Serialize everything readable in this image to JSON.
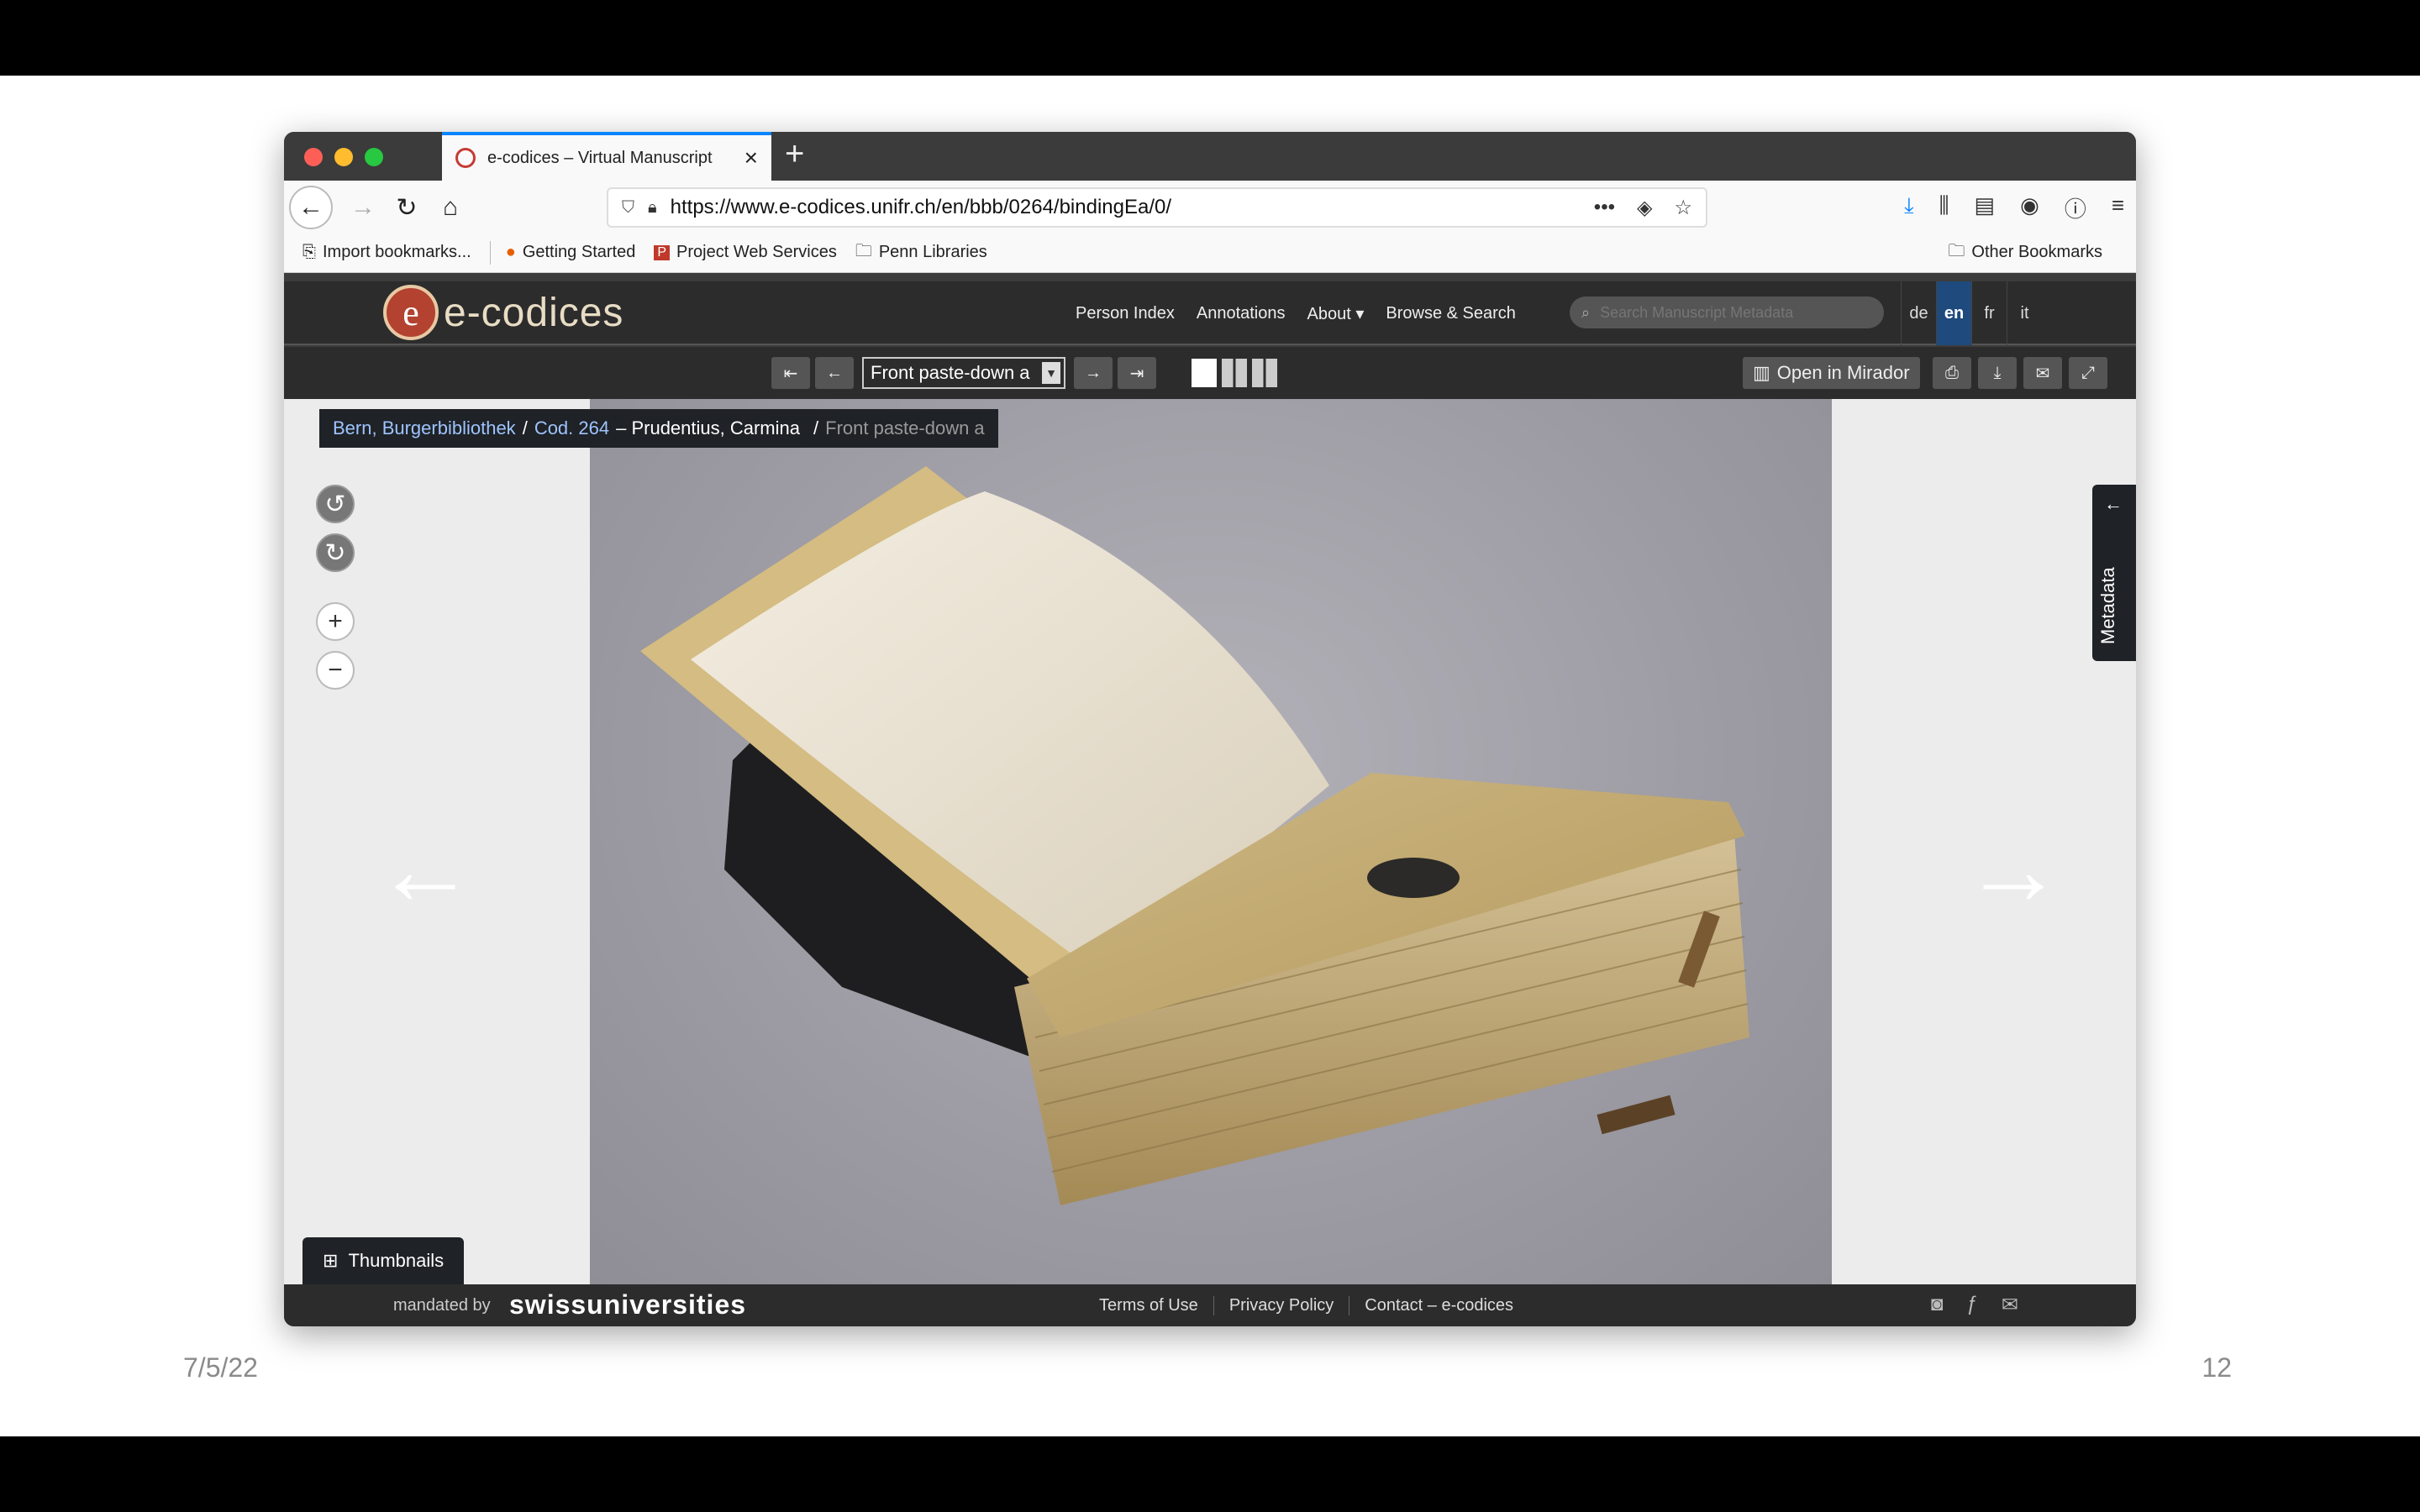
{
  "slide": {
    "date": "7/5/22",
    "page_number": "12"
  },
  "browser": {
    "tab_title": "e-codices – Virtual Manuscript",
    "url": "https://www.e-codices.unifr.ch/en/bbb/0264/bindingEa/0/",
    "bookmarks": [
      "Import bookmarks...",
      "Getting Started",
      "Project Web Services",
      "Penn Libraries"
    ],
    "other_bookmarks": "Other Bookmarks"
  },
  "site": {
    "logo_letter": "e",
    "logo_text": "e-codices",
    "nav": [
      "Person Index",
      "Annotations",
      "About ▾",
      "Browse & Search"
    ],
    "search_placeholder": "Search Manuscript Metadata",
    "languages": [
      "de",
      "en",
      "fr",
      "it"
    ],
    "active_language": "en"
  },
  "viewer": {
    "page_select_value": "Front paste-down a",
    "open_in_mirador": "Open in Mirador",
    "breadcrumb": {
      "library": "Bern, Burgerbibliothek",
      "codex": "Cod. 264",
      "title": "– Prudentius, Carmina",
      "page": "Front paste-down a"
    },
    "metadata_tab": "Metadata",
    "thumbnails_button": "Thumbnails"
  },
  "footer": {
    "mandated_by": "mandated by",
    "swissuniversities": "swissuniversities",
    "links": [
      "Terms of Use",
      "Privacy Policy",
      "Contact – e-codices"
    ]
  }
}
